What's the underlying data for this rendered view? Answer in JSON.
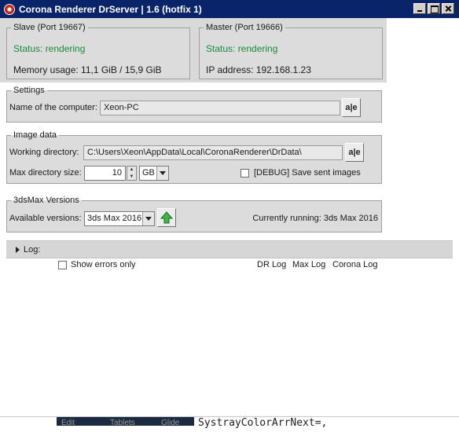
{
  "window": {
    "title": "Corona Renderer DrServer | 1.6 (hotfix 1)",
    "icon": "corona-app-icon"
  },
  "slave": {
    "legend": "Slave (Port 19667)",
    "status": "Status: rendering",
    "memory": "Memory usage: 11,1 GiB / 15,9 GiB"
  },
  "master": {
    "legend": "Master (Port 19666)",
    "status": "Status: rendering",
    "ip": "IP address: 192.168.1.23"
  },
  "settings": {
    "legend": "Settings",
    "computer_label": "Name of the computer:",
    "computer_value": "Xeon-PC",
    "edit_btn": "a|e"
  },
  "image_data": {
    "legend": "Image data",
    "workdir_label": "Working directory:",
    "workdir_value": "C:\\Users\\Xeon\\AppData\\Local\\CoronaRenderer\\DrData\\",
    "edit_btn": "a|e",
    "maxsize_label": "Max directory size:",
    "maxsize_value": "10",
    "unit": "GB",
    "debug_label": "[DEBUG] Save sent images"
  },
  "max_versions": {
    "legend": "3dsMax Versions",
    "available_label": "Available versions:",
    "selected": "3ds Max 2016",
    "running": "Currently running: 3ds Max 2016"
  },
  "log": {
    "label": "Log:",
    "show_errors": "Show errors only",
    "links": [
      "DR Log",
      "Max Log",
      "Corona Log"
    ]
  },
  "background": {
    "code_text": "SystrayColorArrNext=,",
    "taskbar_items": [
      "Edit",
      "Tablets",
      "Glide"
    ]
  },
  "colors": {
    "titlebar": "#0a246a",
    "status_green": "#1a8a3c",
    "group_bg": "#dcdcdc"
  }
}
